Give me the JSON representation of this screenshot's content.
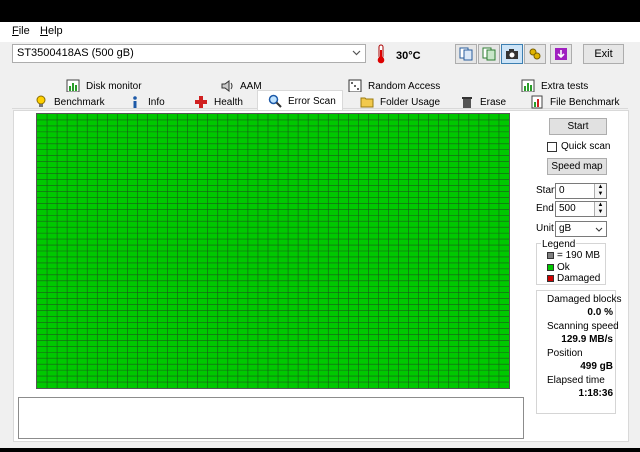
{
  "menu": {
    "file": "File",
    "help": "Help",
    "file_acc": "F",
    "file_rest": "ile",
    "help_acc": "H",
    "help_rest": "elp"
  },
  "drive": {
    "selected": "ST3500418AS (500 gB)"
  },
  "temperature": "30°C",
  "toolbar": {
    "exit_label": "Exit"
  },
  "tabs_row1": [
    {
      "label": "Disk monitor",
      "icon": "chart-icon"
    },
    {
      "label": "AAM",
      "icon": "speaker-icon"
    },
    {
      "label": "Random Access",
      "icon": "dice-icon"
    },
    {
      "label": "Extra tests",
      "icon": "chart-icon"
    }
  ],
  "tabs_row2": [
    {
      "label": "Benchmark",
      "icon": "bulb-icon"
    },
    {
      "label": "Info",
      "icon": "info-icon"
    },
    {
      "label": "Health",
      "icon": "cross-icon"
    },
    {
      "label": "Error Scan",
      "icon": "magnifier-icon"
    },
    {
      "label": "Folder Usage",
      "icon": "folder-icon"
    },
    {
      "label": "Erase",
      "icon": "trash-icon"
    },
    {
      "label": "File Benchmark",
      "icon": "file-chart-icon"
    }
  ],
  "active_tab": "Error Scan",
  "scan": {
    "start_button": "Start",
    "quick_scan_label": "Quick scan",
    "quick_scan_checked": false,
    "speed_map_button": "Speed map",
    "start_label": "Start",
    "start_value": "0",
    "end_label": "End",
    "end_value": "500",
    "unit_label": "Unit",
    "unit_value": "gB"
  },
  "legend": {
    "title": "Legend",
    "block_size": "= 190 MB",
    "ok": "Ok",
    "damaged": "Damaged",
    "colors": {
      "block": "#808080",
      "ok": "#00c800",
      "damaged": "#d00000"
    }
  },
  "stats": {
    "damaged_blocks_label": "Damaged blocks",
    "damaged_blocks_value": "0.0 %",
    "scanning_speed_label": "Scanning speed",
    "scanning_speed_value": "129.9 MB/s",
    "position_label": "Position",
    "position_value": "499 gB",
    "elapsed_label": "Elapsed time",
    "elapsed_value": "1:18:36"
  },
  "grid": {
    "columns": 47,
    "rows": 46,
    "color": "#00c800",
    "scanned_fraction": 1.0
  }
}
